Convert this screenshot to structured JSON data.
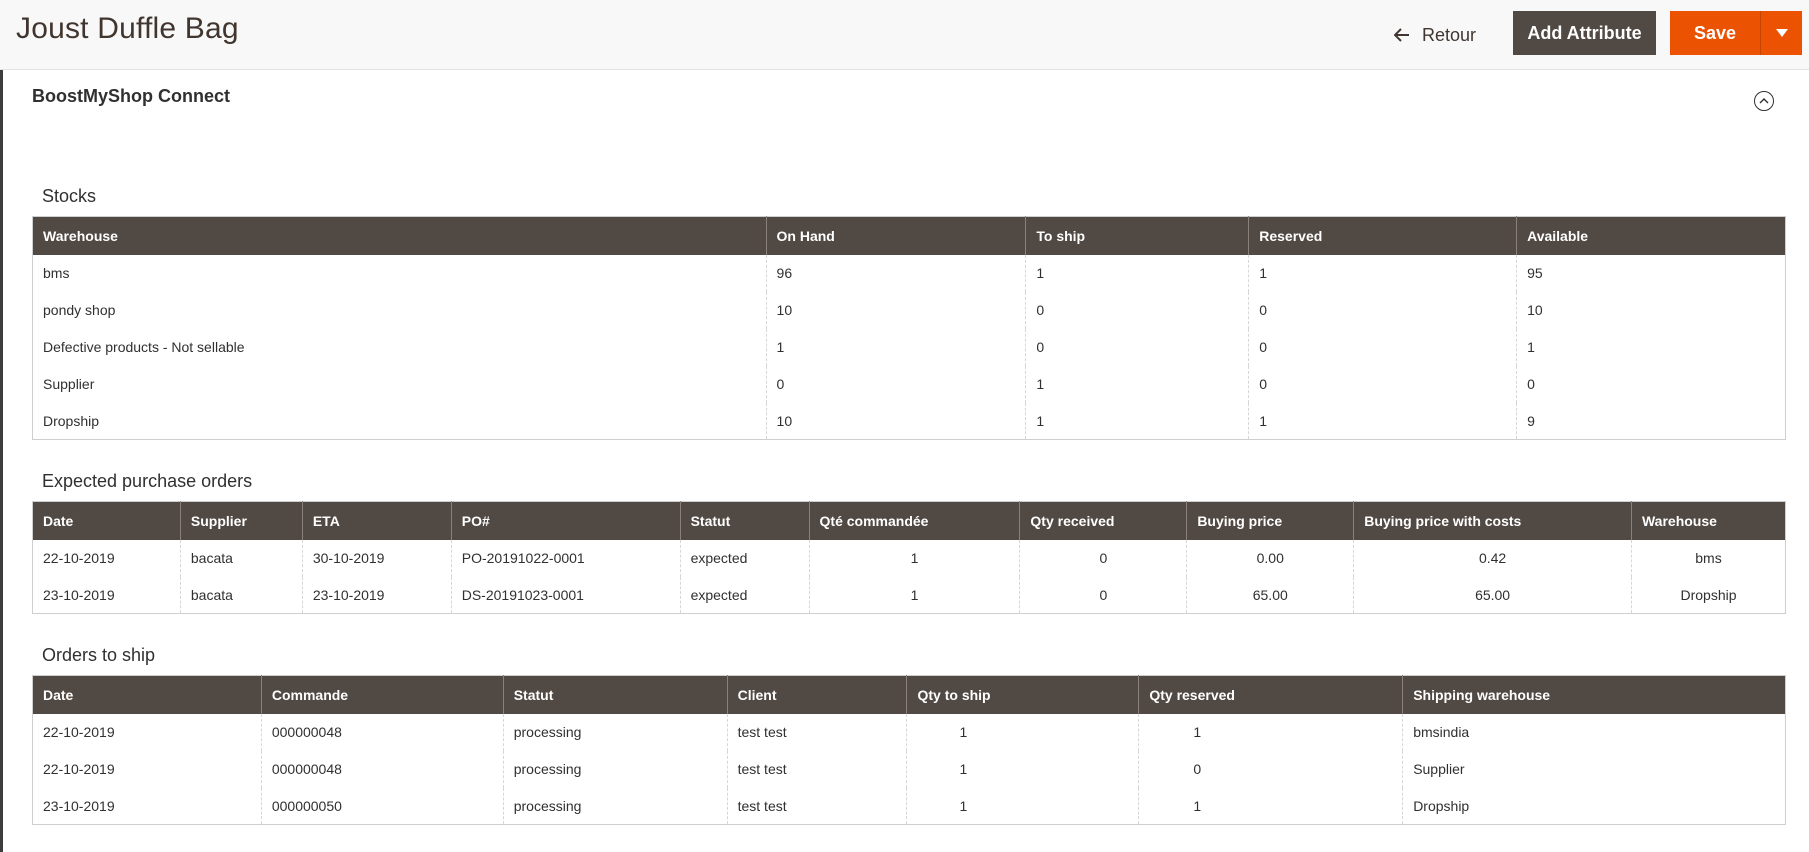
{
  "header": {
    "title": "Joust Duffle Bag",
    "back_label": "Retour",
    "add_attribute_label": "Add Attribute",
    "save_label": "Save"
  },
  "section": {
    "title": "BoostMyShop Connect"
  },
  "stocks": {
    "title": "Stocks",
    "columns": [
      "Warehouse",
      "On Hand",
      "To ship",
      "Reserved",
      "Available"
    ],
    "rows": [
      [
        "bms",
        "96",
        "1",
        "1",
        "95"
      ],
      [
        "pondy shop",
        "10",
        "0",
        "0",
        "10"
      ],
      [
        "Defective products - Not sellable",
        "1",
        "0",
        "0",
        "1"
      ],
      [
        "Supplier",
        "0",
        "1",
        "0",
        "0"
      ],
      [
        "Dropship",
        "10",
        "1",
        "1",
        "9"
      ]
    ]
  },
  "purchase_orders": {
    "title": "Expected purchase orders",
    "columns": [
      "Date",
      "Supplier",
      "ETA",
      "PO#",
      "Statut",
      "Qté commandée",
      "Qty received",
      "Buying price",
      "Buying price with costs",
      "Warehouse"
    ],
    "rows": [
      [
        "22-10-2019",
        "bacata",
        "30-10-2019",
        "PO-20191022-0001",
        "expected",
        "1",
        "0",
        "0.00",
        "0.42",
        "bms"
      ],
      [
        "23-10-2019",
        "bacata",
        "23-10-2019",
        "DS-20191023-0001",
        "expected",
        "1",
        "0",
        "65.00",
        "65.00",
        "Dropship"
      ]
    ]
  },
  "orders_to_ship": {
    "title": "Orders to ship",
    "columns": [
      "Date",
      "Commande",
      "Statut",
      "Client",
      "Qty to ship",
      "Qty reserved",
      "Shipping warehouse"
    ],
    "rows": [
      [
        "22-10-2019",
        "000000048",
        "processing",
        "test test",
        "1",
        "1",
        "bmsindia"
      ],
      [
        "22-10-2019",
        "000000048",
        "processing",
        "test test",
        "1",
        "0",
        "Supplier"
      ],
      [
        "23-10-2019",
        "000000050",
        "processing",
        "test test",
        "1",
        "1",
        "Dropship"
      ]
    ]
  },
  "colors": {
    "header_bg": "#514943",
    "accent": "#eb5202"
  },
  "icons": {
    "back": "arrow-left-icon",
    "save_menu": "caret-down-icon",
    "collapse": "chevron-up-circle-icon"
  }
}
